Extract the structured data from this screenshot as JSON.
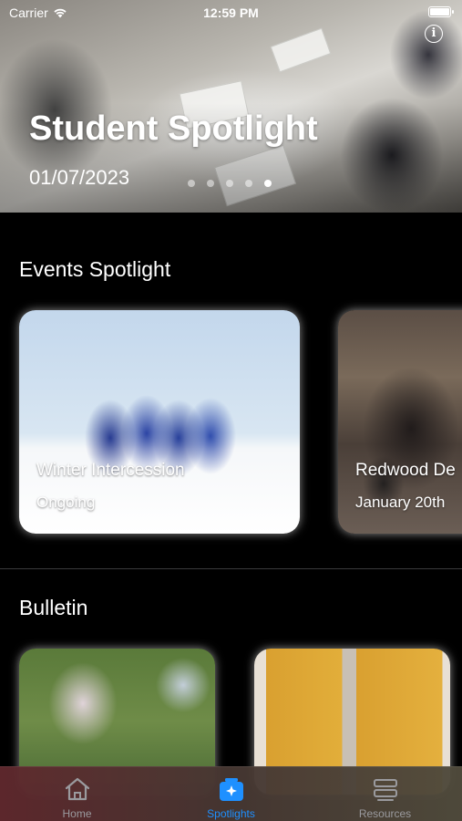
{
  "status_bar": {
    "carrier": "Carrier",
    "time": "12:59 PM"
  },
  "hero": {
    "title": "Student Spotlight",
    "date": "01/07/2023",
    "page_count": 5,
    "active_page": 5
  },
  "events": {
    "title": "Events Spotlight",
    "cards": [
      {
        "title": "Winter Intercession",
        "subtitle": "Ongoing"
      },
      {
        "title": "Redwood De",
        "subtitle": "January 20th"
      }
    ]
  },
  "bulletin": {
    "title": "Bulletin"
  },
  "tabs": [
    {
      "label": "Home",
      "icon": "house-icon"
    },
    {
      "label": "Spotlights",
      "icon": "spotlight-icon"
    },
    {
      "label": "Resources",
      "icon": "server-stack-icon"
    }
  ],
  "colors": {
    "accent": "#1e90ff",
    "inactive_tab": "#9a9a9e",
    "background": "#000000"
  }
}
